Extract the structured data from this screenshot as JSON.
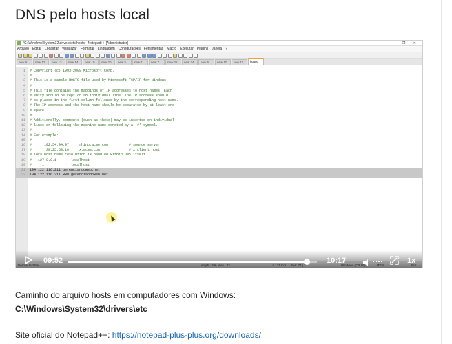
{
  "page": {
    "title": "DNS pelo hosts local",
    "caption": "Caminho do arquivo hosts em computadores com Windows:",
    "path": "C:\\Windows\\System32\\drivers\\etc",
    "site_prefix": "Site oficial do Notepad++: ",
    "site_link": "https://notepad-plus-plus.org/downloads/"
  },
  "notepad": {
    "window_title": "*C:\\Windows\\System32\\drivers\\etc\\hosts - Notepad++ [Administrator]",
    "window_buttons": "– ❐ ✕",
    "menu": [
      "Arquivo",
      "Editar",
      "Localizar",
      "Visualizar",
      "Formatar",
      "Linguagem",
      "Configurações",
      "Ferramentas",
      "Macro",
      "Executar",
      "Plugins",
      "Janela",
      "?"
    ],
    "tabs": [
      "new 9",
      "new 12",
      "new 13",
      "new 14",
      "new 19",
      "new 20",
      "new 5",
      "new 1",
      "new 7",
      "new 25",
      "new 24",
      "new 6",
      "new 10",
      "new 11",
      "hosts"
    ],
    "active_tab": 14,
    "lines": [
      {
        "n": "1",
        "t": "# Copyright (c) 1993-2009 Microsoft Corp."
      },
      {
        "n": "2",
        "t": "#"
      },
      {
        "n": "3",
        "t": "# This is a sample HOSTS file used by Microsoft TCP/IP for Windows."
      },
      {
        "n": "4",
        "t": "#"
      },
      {
        "n": "5",
        "t": "# This file contains the mappings of IP addresses to host names. Each"
      },
      {
        "n": "6",
        "t": "# entry should be kept on an individual line. The IP address should"
      },
      {
        "n": "7",
        "t": "# be placed in the first column followed by the corresponding host name."
      },
      {
        "n": "8",
        "t": "# The IP address and the host name should be separated by at least one"
      },
      {
        "n": "9",
        "t": "# space."
      },
      {
        "n": "10",
        "t": "#"
      },
      {
        "n": "11",
        "t": "# Additionally, comments (such as these) may be inserted on individual"
      },
      {
        "n": "12",
        "t": "# lines or following the machine name denoted by a '#' symbol."
      },
      {
        "n": "13",
        "t": "#"
      },
      {
        "n": "14",
        "t": "# For example:"
      },
      {
        "n": "15",
        "t": "#"
      },
      {
        "n": "16",
        "t": "#      102.54.94.97     rhino.acme.com          # source server"
      },
      {
        "n": "17",
        "t": "#       38.25.63.10     x.acme.com              # x client host"
      },
      {
        "n": "18",
        "t": "# localhost name resolution is handled within DNS itself."
      },
      {
        "n": "19",
        "t": "#   127.0.0.1       localhost"
      },
      {
        "n": "20",
        "t": "#   ::1             localhost"
      },
      {
        "n": "21",
        "t": "194.122.116.211 gerenciandoweb.net"
      },
      {
        "n": "22",
        "t": "194.122.116.211 www.gerenciandoweb.net"
      }
    ],
    "status": {
      "file_type": "Normal text file",
      "length": "length : 896   lines : 22",
      "position": "Ln : 21   Col : 1   Sel : 74 | 2",
      "eol": "Windows (CR LF)",
      "encoding": "UTF-8",
      "mode": "INS"
    }
  },
  "player": {
    "current_time": "09:52",
    "duration": "10:17",
    "speed": "1x",
    "progress_percent": 95.9
  },
  "colors": {
    "link": "#1a66b3",
    "comment": "#2a6a1a",
    "selection": "#c8c8c8"
  }
}
